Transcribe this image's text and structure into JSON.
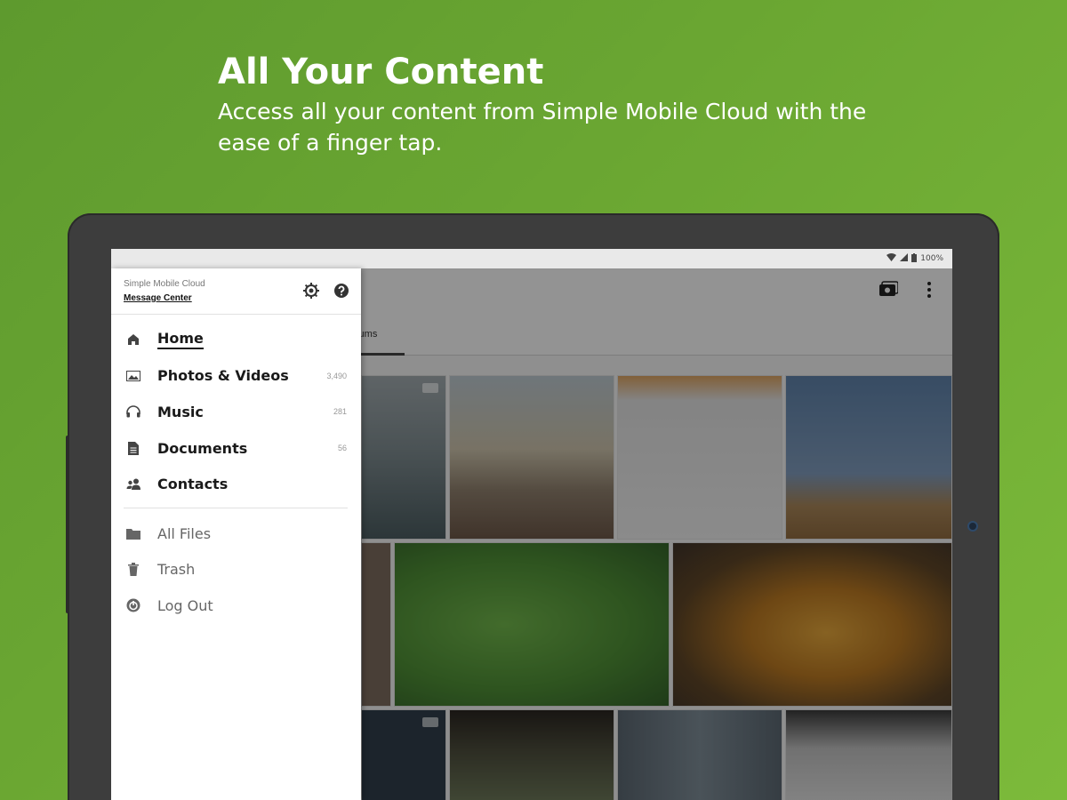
{
  "promo": {
    "title": "All Your Content",
    "subtitle": "Access all your content from Simple Mobile Cloud with the ease of a finger tap."
  },
  "statusbar": {
    "battery": "100%",
    "icons": [
      "wifi-icon",
      "signal-icon",
      "battery-icon"
    ]
  },
  "drawer": {
    "app_name": "Simple Mobile Cloud",
    "message_center": "Message Center",
    "header_icons": [
      "settings-icon",
      "help-icon"
    ],
    "nav": [
      {
        "label": "Home",
        "count": "",
        "icon": "home-icon",
        "active": true
      },
      {
        "label": "Photos & Videos",
        "count": "3,490",
        "icon": "photo-icon"
      },
      {
        "label": "Music",
        "count": "281",
        "icon": "headphones-icon"
      },
      {
        "label": "Documents",
        "count": "56",
        "icon": "document-icon"
      },
      {
        "label": "Contacts",
        "count": "",
        "icon": "contacts-icon"
      }
    ],
    "secondary": [
      {
        "label": "All Files",
        "icon": "folder-icon"
      },
      {
        "label": "Trash",
        "icon": "trash-icon"
      },
      {
        "label": "Log Out",
        "icon": "logout-icon"
      }
    ]
  },
  "app": {
    "tab_albums": "lbums",
    "appbar_icons": [
      "camera-folder-icon",
      "overflow-menu-icon"
    ]
  }
}
